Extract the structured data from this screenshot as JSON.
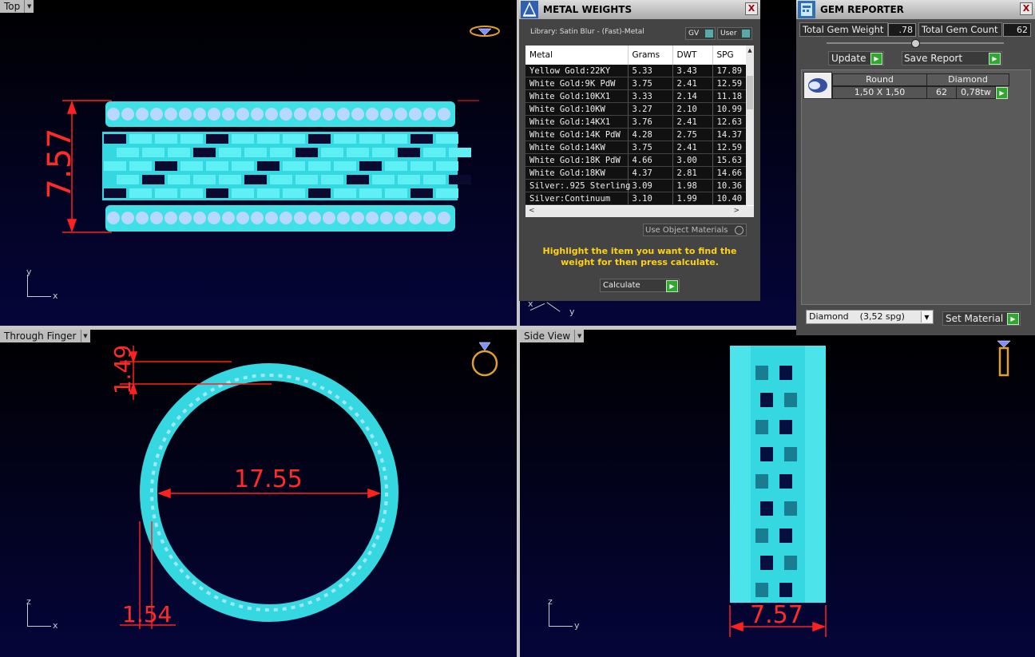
{
  "viewports": {
    "top": {
      "label": "Top",
      "dimension": "7.57",
      "axis_v": "y",
      "axis_h": "x"
    },
    "through_finger": {
      "label": "Through Finger",
      "dims": [
        "1.49",
        "17.55",
        "1.54"
      ],
      "axis_v": "z",
      "axis_h": "x"
    },
    "side": {
      "label": "Side View",
      "dimension": "7.57",
      "axis_v": "z",
      "axis_h": "y"
    },
    "bottom_right_axis": {
      "axis_v": "x",
      "axis_h": "y"
    }
  },
  "metal_weights": {
    "title": "METAL WEIGHTS",
    "close": "X",
    "library": "Library: Satin Blur - (Fast)-Metal",
    "gv_label": "GV",
    "user_label": "User",
    "columns": [
      "Metal",
      "Grams",
      "DWT",
      "SPG"
    ],
    "rows": [
      [
        "Yellow Gold:22KY",
        "5.33",
        "3.43",
        "17.89"
      ],
      [
        "White Gold:9K PdW",
        "3.75",
        "2.41",
        "12.59"
      ],
      [
        "White Gold:10KX1",
        "3.33",
        "2.14",
        "11.18"
      ],
      [
        "White Gold:10KW",
        "3.27",
        "2.10",
        "10.99"
      ],
      [
        "White Gold:14KX1",
        "3.76",
        "2.41",
        "12.63"
      ],
      [
        "White Gold:14K PdW",
        "4.28",
        "2.75",
        "14.37"
      ],
      [
        "White Gold:14KW",
        "3.75",
        "2.41",
        "12.59"
      ],
      [
        "White Gold:18K PdW",
        "4.66",
        "3.00",
        "15.63"
      ],
      [
        "White Gold:18KW",
        "4.37",
        "2.81",
        "14.66"
      ],
      [
        "Silver:.925 Sterling",
        "3.09",
        "1.98",
        "10.36"
      ],
      [
        "Silver:Continuum",
        "3.10",
        "1.99",
        "10.40"
      ]
    ],
    "use_object_materials": "Use Object Materials",
    "hint": "Highlight the item you want to find the weight for then press calculate.",
    "calculate": "Calculate"
  },
  "gem_reporter": {
    "title": "GEM REPORTER",
    "close": "X",
    "total_weight_label": "Total Gem Weight",
    "total_weight_value": ".78",
    "total_count_label": "Total Gem Count",
    "total_count_value": "62",
    "update": "Update",
    "save_report": "Save Report",
    "gem": {
      "shape": "Round",
      "material": "Diamond",
      "size": "1,50 X 1,50",
      "count": "62",
      "weight": "0,78tw"
    },
    "material_select": "Diamond    (3,52 spg)",
    "set_material": "Set Material"
  }
}
